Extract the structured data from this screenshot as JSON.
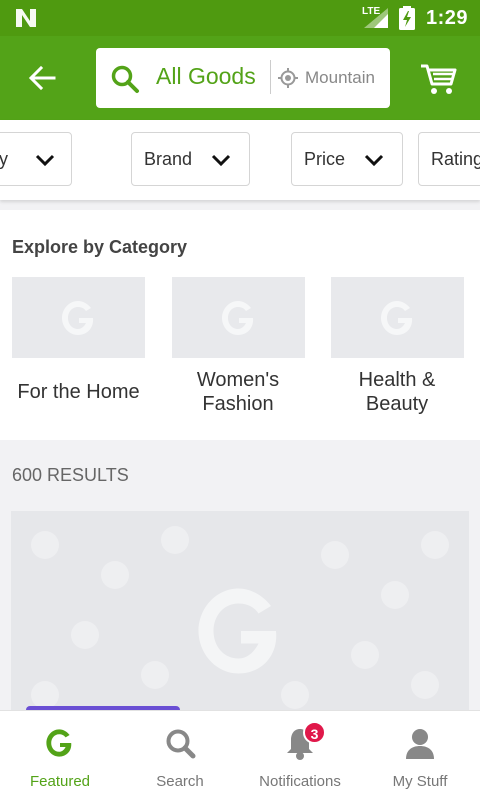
{
  "status_bar": {
    "network": "LTE",
    "time": "1:29"
  },
  "app_bar": {
    "search_query": "All Goods",
    "location": "Mountain"
  },
  "filters": [
    {
      "label": "ry"
    },
    {
      "label": "Brand"
    },
    {
      "label": "Price"
    },
    {
      "label": "Rating"
    }
  ],
  "explore": {
    "title": "Explore by Category",
    "categories": [
      {
        "label": "For the Home"
      },
      {
        "label": "Women's Fashion"
      },
      {
        "label": "Health & Beauty"
      }
    ]
  },
  "results": {
    "count_label": "600 RESULTS"
  },
  "bottom_nav": {
    "items": [
      {
        "label": "Featured",
        "active": true
      },
      {
        "label": "Search"
      },
      {
        "label": "Notifications",
        "badge": "3"
      },
      {
        "label": "My Stuff"
      }
    ]
  },
  "colors": {
    "brand_green": "#53a318",
    "status_green": "#4f9a10",
    "badge_red": "#e0184a",
    "promo_purple": "#6a4fd4"
  }
}
